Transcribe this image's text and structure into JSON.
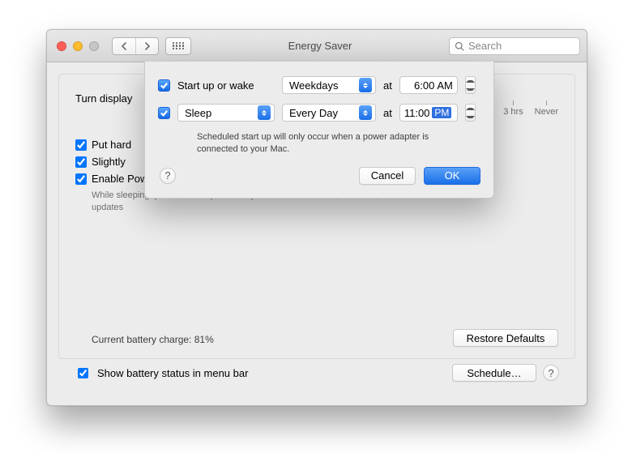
{
  "window": {
    "title": "Energy Saver",
    "search_placeholder": "Search"
  },
  "panel": {
    "turn_display_label": "Turn display",
    "slider_ticks": [
      "3 hrs",
      "Never"
    ],
    "put_hard_label": "Put hard",
    "slightly_label": "Slightly",
    "power_nap_label": "Enable Power Nap while on battery power",
    "power_nap_sub": "While sleeping, your Mac can periodically check for new email, calendar, and other iCloud updates",
    "battery_status": "Current battery charge: 81%",
    "restore_defaults": "Restore Defaults"
  },
  "footer": {
    "show_battery_label": "Show battery status in menu bar",
    "schedule_button": "Schedule…"
  },
  "modal": {
    "row1": {
      "label": "Start up or wake",
      "frequency": "Weekdays",
      "at": "at",
      "time_value": "6:00",
      "time_period": "AM"
    },
    "row2": {
      "action": "Sleep",
      "frequency": "Every Day",
      "at": "at",
      "time_value": "11:00",
      "time_period": "PM"
    },
    "note": "Scheduled start up will only occur when a power adapter is connected to your Mac.",
    "cancel": "Cancel",
    "ok": "OK"
  }
}
